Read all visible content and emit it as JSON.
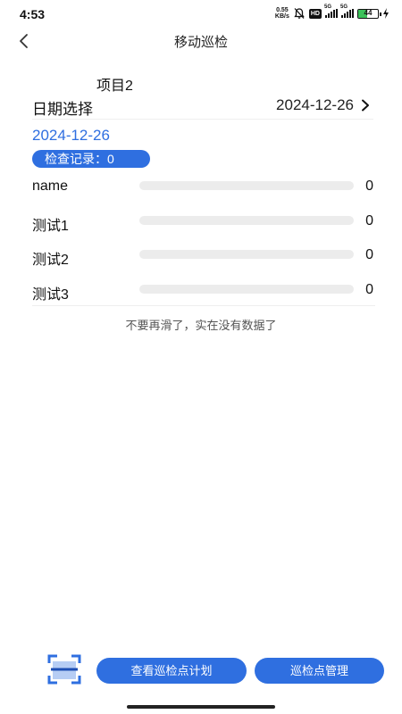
{
  "status_bar": {
    "time": "4:53",
    "net_speed_value": "0.55",
    "net_speed_unit": "KB/s",
    "hd_label": "HD",
    "sim1_label": "5G",
    "sim2_label": "5G",
    "battery_percent": "44",
    "icons": [
      "mute-icon",
      "hd-icon",
      "signal-icon",
      "signal-icon",
      "battery-icon",
      "charging-icon"
    ]
  },
  "nav": {
    "title": "移动巡检",
    "back_icon": "back-chevron-icon"
  },
  "project": {
    "name": "项目2"
  },
  "date_picker": {
    "label": "日期选择",
    "value": "2024-12-26"
  },
  "selected_date": "2024-12-26",
  "record_badge": "检查记录：0",
  "items": [
    {
      "name": "name",
      "count": "0",
      "progress": 0
    },
    {
      "name": "测试1",
      "count": "0",
      "progress": 0
    },
    {
      "name": "测试2",
      "count": "0",
      "progress": 0
    },
    {
      "name": "测试3",
      "count": "0",
      "progress": 0
    }
  ],
  "end_of_list": "不要再滑了，实在没有数据了",
  "bottom": {
    "scan_icon": "scan-icon",
    "plan_button": "查看巡检点计划",
    "manage_button": "巡检点管理"
  },
  "colors": {
    "accent": "#2f6fe0",
    "bar_track": "#ececec",
    "battery": "#3cc25a"
  }
}
